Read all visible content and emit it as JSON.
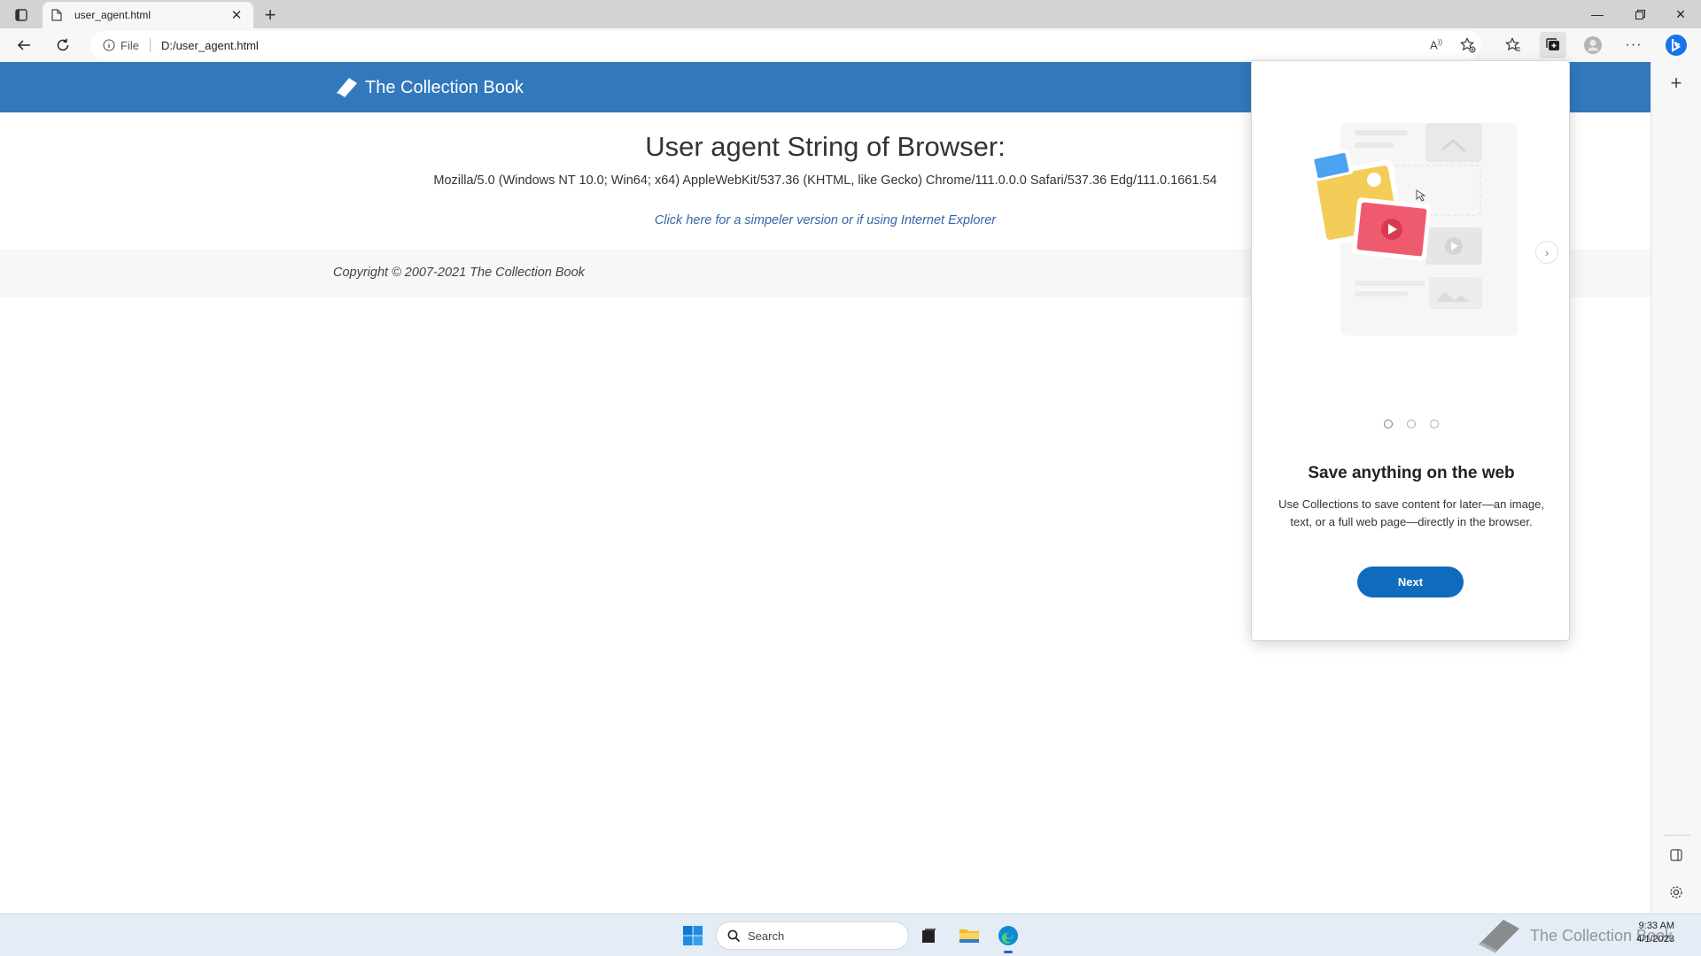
{
  "browser": {
    "tab_title": "user_agent.html",
    "address_label": "File",
    "address_url": "D:/user_agent.html",
    "icons": {
      "tab_actions": "tab-actions-icon",
      "tab_page": "page-icon",
      "close_tab": "close-icon",
      "new_tab": "plus-icon",
      "back": "back-arrow-icon",
      "refresh": "refresh-icon",
      "site_info": "info-icon",
      "read_aloud": "read-aloud-icon",
      "favorite": "star-add-icon",
      "favorites": "favorites-icon",
      "collections": "collections-icon",
      "profile": "profile-icon",
      "more": "more-icon",
      "copilot": "bing-icon"
    }
  },
  "page": {
    "brand": "The Collection Book",
    "heading": "User agent String of Browser:",
    "user_agent": "Mozilla/5.0 (Windows NT 10.0; Win64; x64) AppleWebKit/537.36 (KHTML, like Gecko) Chrome/111.0.0.0 Safari/537.36 Edg/111.0.1661.54",
    "simple_link": "Click here for a simpeler version or if using Internet Explorer",
    "copyright": "Copyright © 2007-2021 The Collection Book",
    "header_color": "#3278bd"
  },
  "collections_flyout": {
    "title": "Save anything on the web",
    "description": "Use Collections to save content for later—an image, text, or a full web page—directly in the browser.",
    "next_label": "Next",
    "active_dot": 1,
    "dot_count": 3,
    "accent": "#0f6cbd"
  },
  "taskbar": {
    "search_placeholder": "Search",
    "time": "9:33 AM",
    "date": "4/1/2023",
    "watermark": "The Collection Book"
  }
}
